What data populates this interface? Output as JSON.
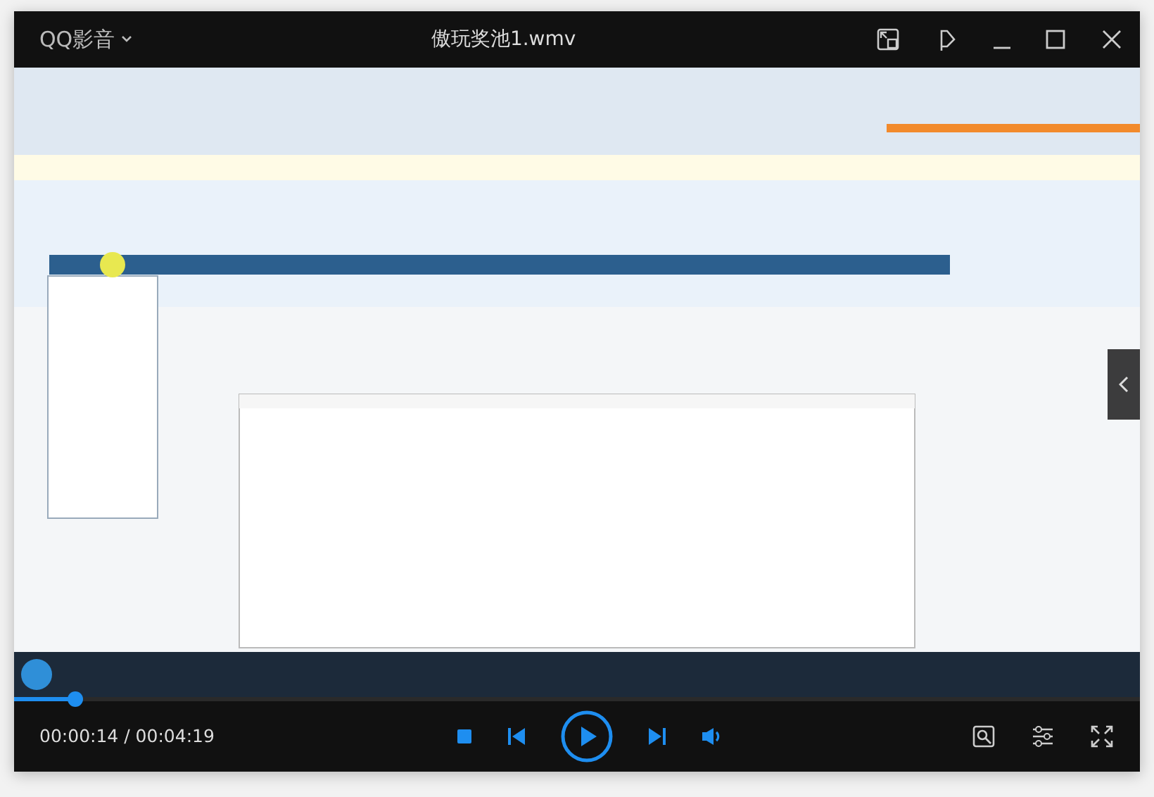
{
  "app": {
    "name": "QQ影音"
  },
  "window": {
    "title": "傲玩奖池1.wmv"
  },
  "playback": {
    "level": 0.054,
    "time": "00:00:14 / 00:04:19"
  }
}
